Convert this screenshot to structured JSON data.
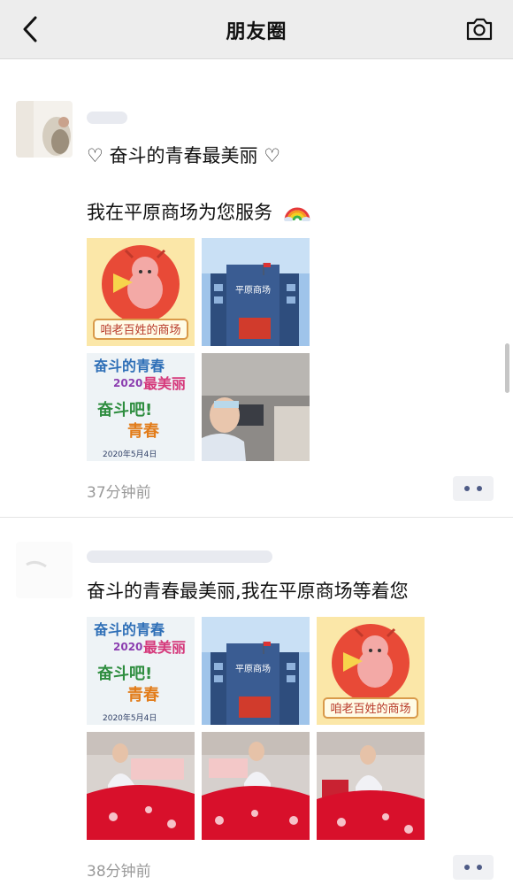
{
  "header": {
    "title": "朋友圈"
  },
  "posts": [
    {
      "line1": "奋斗的青春最美丽",
      "line2": "我在平原商场为您服务",
      "time": "37分钟前",
      "thumbs": [
        "mascot-cartoon",
        "mall-building",
        "youth-poster",
        "staff-in-store"
      ]
    },
    {
      "line1": "奋斗的青春最美丽,我在平原商场等着您",
      "time": "38分钟前",
      "thumbs": [
        "youth-poster",
        "mall-building",
        "mascot-cartoon",
        "staff-bedding-1",
        "staff-bedding-2",
        "staff-bedding-3"
      ]
    }
  ],
  "images": {
    "mascot_caption": "咱老百姓的商场",
    "poster_line1": "奋斗的青春",
    "poster_year": "2020",
    "poster_line2": "最美丽",
    "poster_line3": "奋斗吧!",
    "poster_line4": "青春",
    "poster_date": "2020年5月4日",
    "mall_sign": "平原商场"
  },
  "colors": {
    "link_blue": "#576b95",
    "time_gray": "#9a9a9a",
    "header_bg": "#ededed"
  }
}
